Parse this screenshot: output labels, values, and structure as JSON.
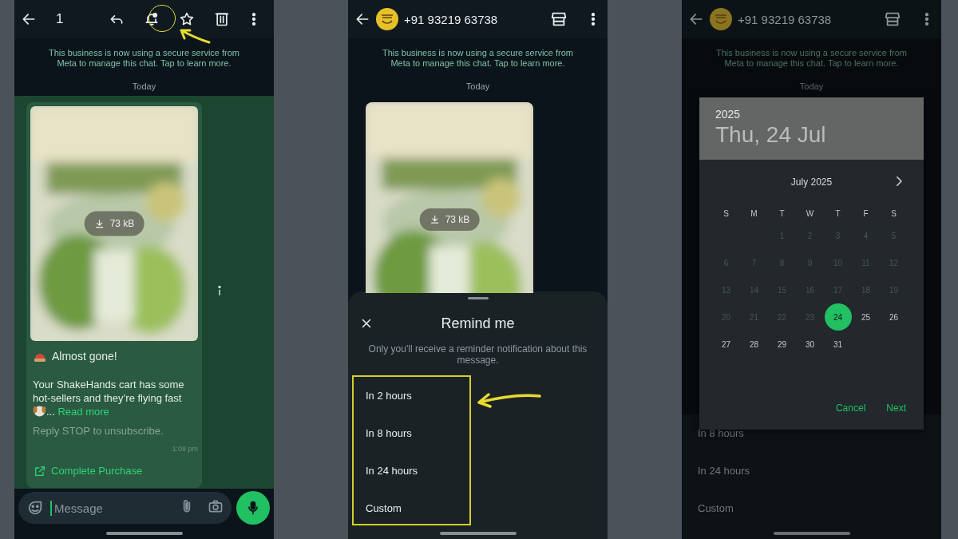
{
  "selection_screen": {
    "header": {
      "selected_count": "1"
    },
    "notice": "This business is now using a secure service from Meta to manage this chat. Tap to learn more.",
    "date_divider": "Today",
    "message": {
      "file_size": "73 kB",
      "title": "Almost gone!",
      "body": "Your ShakeHands cart has some hot-sellers and they’re flying fast",
      "ellipsis": "...",
      "read_more": "Read more",
      "footer": "Reply STOP to unsubscribe.",
      "time": "1:08 pm",
      "action": "Complete Purchase"
    },
    "composer": {
      "placeholder": "Message"
    }
  },
  "reminder_screen": {
    "header": {
      "contact": "+91 93219 63738"
    },
    "notice": "This business is now using a secure service from Meta to manage this chat. Tap to learn more.",
    "date_divider": "Today",
    "message": {
      "file_size": "73 kB"
    },
    "sheet": {
      "title": "Remind me",
      "description": "Only you'll receive a reminder notification about this message.",
      "options": [
        {
          "label": "In 2 hours"
        },
        {
          "label": "In 8 hours"
        },
        {
          "label": "In 24 hours"
        },
        {
          "label": "Custom"
        }
      ]
    }
  },
  "date_picker_screen": {
    "header": {
      "contact": "+91 93219 63738"
    },
    "notice": "This business is now using a secure service from Meta to manage this chat. Tap to learn more.",
    "date_divider": "Today",
    "picker": {
      "year": "2025",
      "date": "Thu, 24 Jul",
      "month": "July 2025",
      "weekdays": [
        "S",
        "M",
        "T",
        "W",
        "T",
        "F",
        "S"
      ],
      "first_week_aligned_end": true,
      "weeks": [
        [
          {
            "label": "1",
            "disabled": true,
            "selected": false
          },
          {
            "label": "2",
            "disabled": true,
            "selected": false
          },
          {
            "label": "3",
            "disabled": true,
            "selected": false
          },
          {
            "label": "4",
            "disabled": true,
            "selected": false
          },
          {
            "label": "5",
            "disabled": true,
            "selected": false
          }
        ],
        [
          {
            "label": "6",
            "disabled": true,
            "selected": false
          },
          {
            "label": "7",
            "disabled": true,
            "selected": false
          },
          {
            "label": "8",
            "disabled": true,
            "selected": false
          },
          {
            "label": "9",
            "disabled": true,
            "selected": false
          },
          {
            "label": "10",
            "disabled": true,
            "selected": false
          },
          {
            "label": "11",
            "disabled": true,
            "selected": false
          },
          {
            "label": "12",
            "disabled": true,
            "selected": false
          }
        ],
        [
          {
            "label": "13",
            "disabled": true,
            "selected": false
          },
          {
            "label": "14",
            "disabled": true,
            "selected": false
          },
          {
            "label": "15",
            "disabled": true,
            "selected": false
          },
          {
            "label": "16",
            "disabled": true,
            "selected": false
          },
          {
            "label": "17",
            "disabled": true,
            "selected": false
          },
          {
            "label": "18",
            "disabled": true,
            "selected": false
          },
          {
            "label": "19",
            "disabled": true,
            "selected": false
          }
        ],
        [
          {
            "label": "20",
            "disabled": true,
            "selected": false
          },
          {
            "label": "21",
            "disabled": true,
            "selected": false
          },
          {
            "label": "22",
            "disabled": true,
            "selected": false
          },
          {
            "label": "23",
            "disabled": true,
            "selected": false
          },
          {
            "label": "24",
            "disabled": false,
            "selected": true
          },
          {
            "label": "25",
            "disabled": false,
            "selected": false
          },
          {
            "label": "26",
            "disabled": false,
            "selected": false
          }
        ],
        [
          {
            "label": "27",
            "disabled": false,
            "selected": false
          },
          {
            "label": "28",
            "disabled": false,
            "selected": false
          },
          {
            "label": "29",
            "disabled": false,
            "selected": false
          },
          {
            "label": "30",
            "disabled": false,
            "selected": false
          },
          {
            "label": "31",
            "disabled": false,
            "selected": false
          }
        ]
      ],
      "buttons": [
        "Cancel",
        "Next"
      ]
    },
    "background_options": [
      "In 8 hours",
      "In 24 hours",
      "Custom"
    ]
  }
}
